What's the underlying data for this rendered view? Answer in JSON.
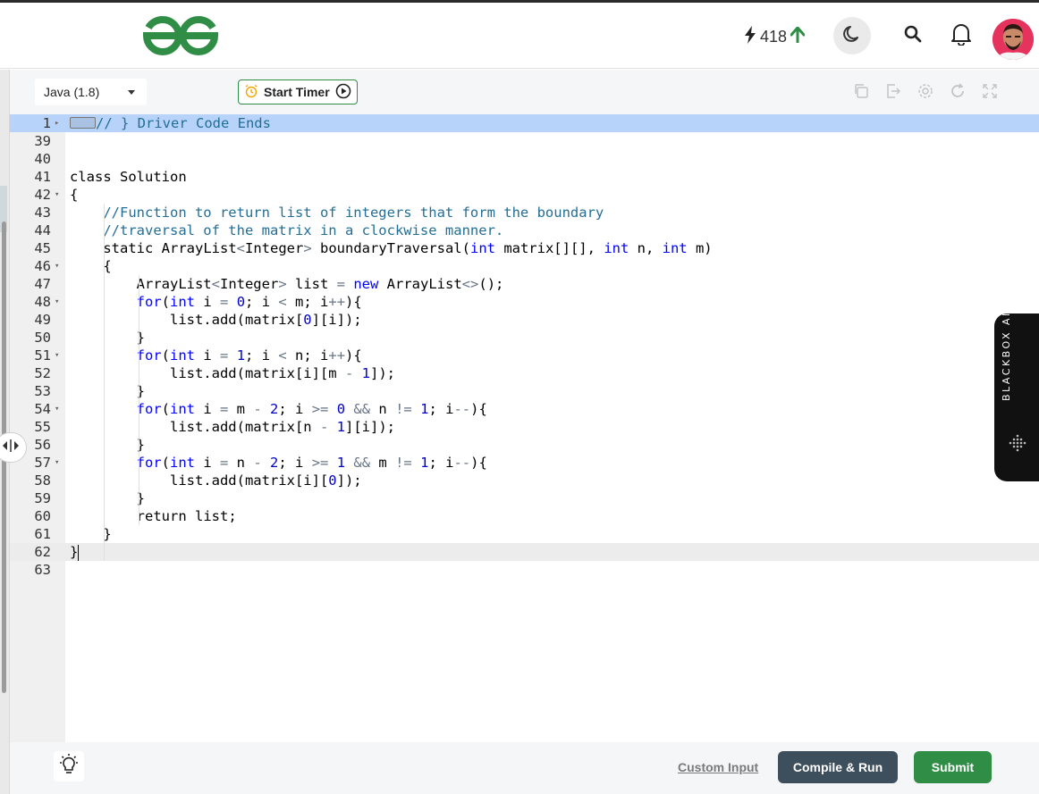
{
  "header": {
    "streak_count": "418",
    "colors": {
      "brand": "#2f8d46",
      "theme_btn_bg": "#eaeaea"
    }
  },
  "toolbar": {
    "language": "Java (1.8)",
    "timer_label": "Start Timer",
    "icons": [
      "copy-icon",
      "export-icon",
      "settings-icon",
      "reset-icon",
      "fullscreen-icon"
    ]
  },
  "editor": {
    "lines": [
      {
        "num": "1",
        "fold": "▸",
        "code": "// } Driver Code Ends"
      },
      {
        "num": "39",
        "fold": "",
        "code": ""
      },
      {
        "num": "40",
        "fold": "",
        "code": ""
      },
      {
        "num": "41",
        "fold": "",
        "code": "class Solution"
      },
      {
        "num": "42",
        "fold": "▾",
        "code": "{"
      },
      {
        "num": "43",
        "fold": "",
        "code": "    //Function to return list of integers that form the boundary"
      },
      {
        "num": "44",
        "fold": "",
        "code": "    //traversal of the matrix in a clockwise manner."
      },
      {
        "num": "45",
        "fold": "",
        "code": "    static ArrayList<Integer> boundaryTraversal(int matrix[][], int n, int m)"
      },
      {
        "num": "46",
        "fold": "▾",
        "code": "    {"
      },
      {
        "num": "47",
        "fold": "",
        "code": "        ArrayList<Integer> list = new ArrayList<>();"
      },
      {
        "num": "48",
        "fold": "▾",
        "code": "        for(int i = 0; i < m; i++){"
      },
      {
        "num": "49",
        "fold": "",
        "code": "            list.add(matrix[0][i]);"
      },
      {
        "num": "50",
        "fold": "",
        "code": "        }"
      },
      {
        "num": "51",
        "fold": "▾",
        "code": "        for(int i = 1; i < n; i++){"
      },
      {
        "num": "52",
        "fold": "",
        "code": "            list.add(matrix[i][m - 1]);"
      },
      {
        "num": "53",
        "fold": "",
        "code": "        }"
      },
      {
        "num": "54",
        "fold": "▾",
        "code": "        for(int i = m - 2; i >= 0 && n != 1; i--){"
      },
      {
        "num": "55",
        "fold": "",
        "code": "            list.add(matrix[n - 1][i]);"
      },
      {
        "num": "56",
        "fold": "",
        "code": "        }"
      },
      {
        "num": "57",
        "fold": "▾",
        "code": "        for(int i = n - 2; i >= 1 && m != 1; i--){"
      },
      {
        "num": "58",
        "fold": "",
        "code": "            list.add(matrix[i][0]);"
      },
      {
        "num": "59",
        "fold": "",
        "code": "        }"
      },
      {
        "num": "60",
        "fold": "",
        "code": "        return list;"
      },
      {
        "num": "61",
        "fold": "",
        "code": "    }"
      },
      {
        "num": "62",
        "fold": "",
        "code": "}"
      },
      {
        "num": "63",
        "fold": "",
        "code": ""
      }
    ]
  },
  "blackbox": {
    "label": "BLACKBOX AI"
  },
  "footer": {
    "custom_input": "Custom Input",
    "compile_run": "Compile & Run",
    "submit": "Submit"
  }
}
